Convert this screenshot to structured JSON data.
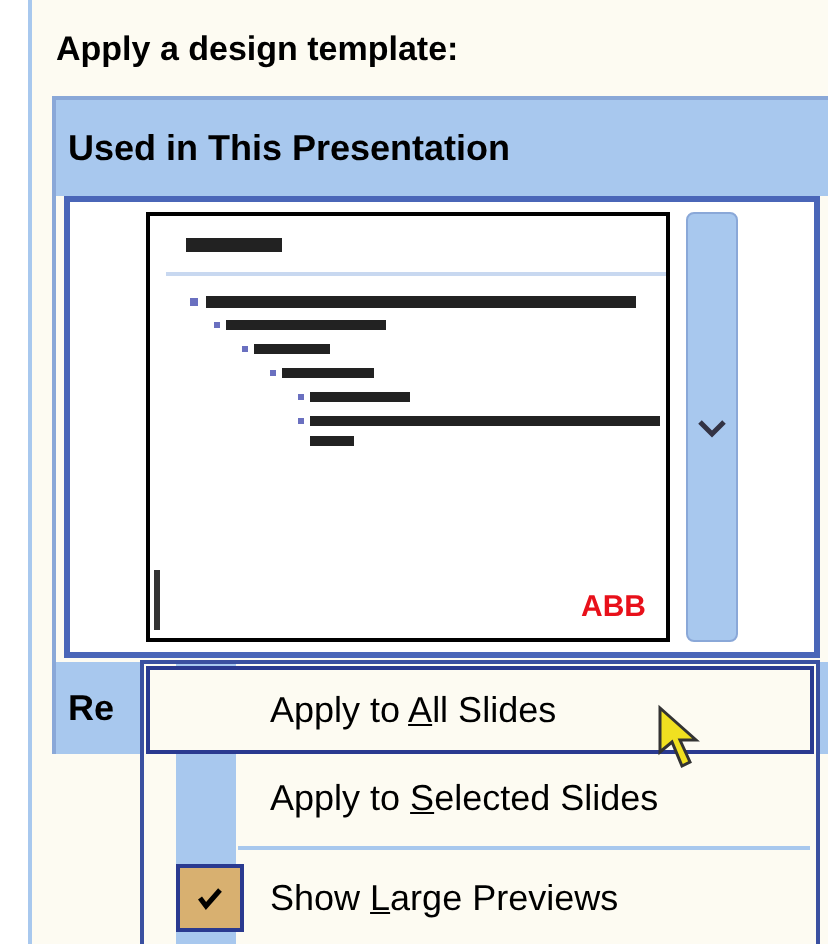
{
  "pane_title": "Apply a design template:",
  "sections": [
    {
      "title": "Used in This Presentation"
    },
    {
      "title": "Re"
    }
  ],
  "thumbnail": {
    "logo": "ABB",
    "selected": true
  },
  "context_menu": {
    "items": [
      {
        "kind": "command",
        "label_before": "Apply to ",
        "accelerator": "A",
        "label_after": "ll Slides",
        "selected": true
      },
      {
        "kind": "command",
        "label_before": "Apply to ",
        "accelerator": "S",
        "label_after": "elected Slides",
        "selected": false
      },
      {
        "kind": "separator"
      },
      {
        "kind": "toggle",
        "label_before": "Show ",
        "accelerator": "L",
        "label_after": "arge Previews",
        "selected": false,
        "checked": true
      }
    ]
  }
}
